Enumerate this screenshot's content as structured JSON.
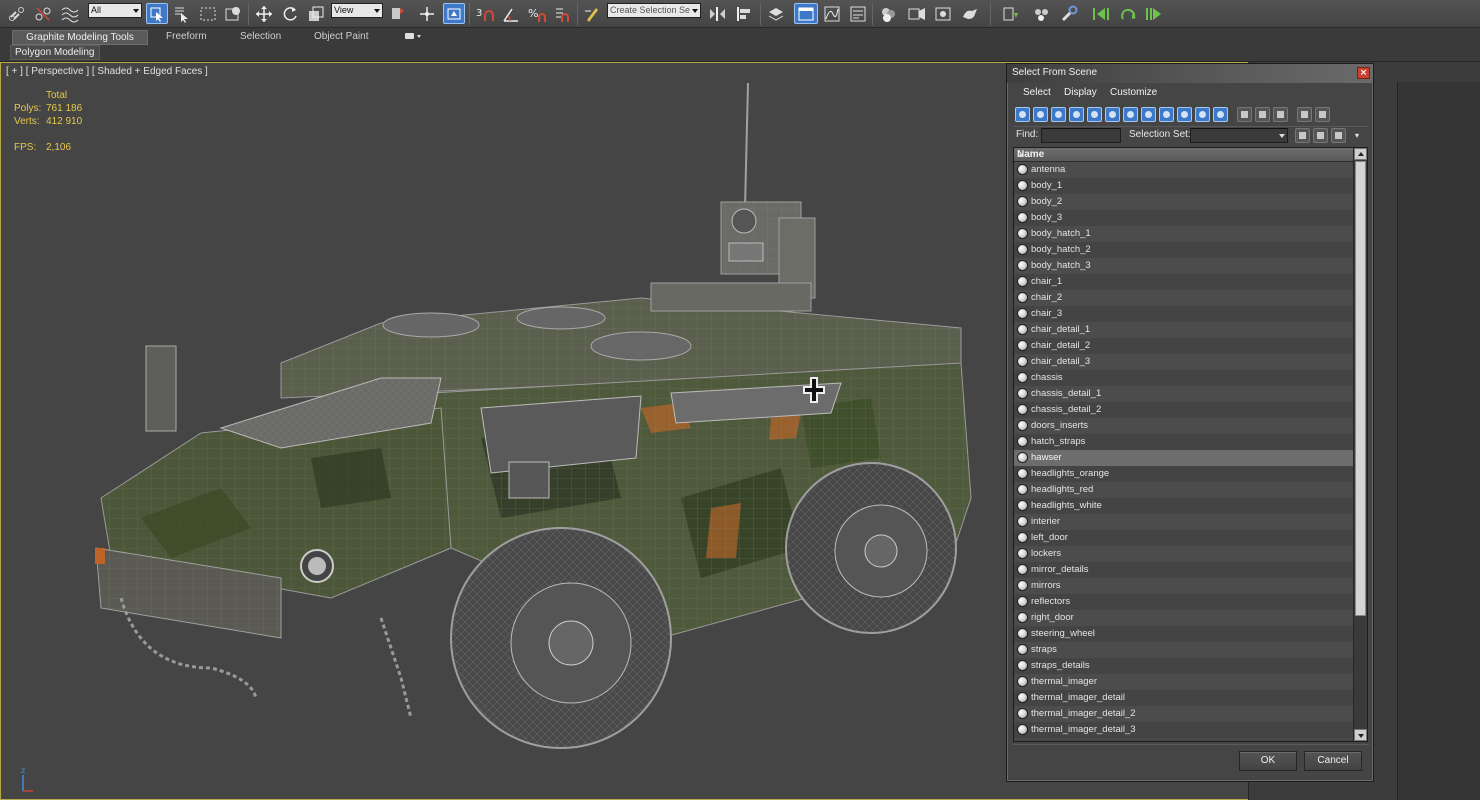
{
  "toolbar": {
    "filter_selected": "All",
    "ref_coord_selected": "View",
    "named_selection_placeholder": "Create Selection Se",
    "snap_labels": [
      "3",
      "%"
    ],
    "icons": [
      "link-icon",
      "unlink-icon",
      "bind-space-warp-icon",
      "select-object-icon",
      "select-by-name-icon",
      "rect-selection-icon",
      "window-crossing-icon",
      "move-icon",
      "rotate-icon",
      "scale-icon",
      "pivot-icon",
      "select-manipulate-icon",
      "keyboard-shortcut-icon",
      "snap-icon",
      "angle-snap-icon",
      "percent-snap-icon",
      "spinner-snap-icon",
      "edit-named-selection-icon",
      "mirror-icon",
      "align-icon",
      "layer-explorer-icon",
      "scene-explorer-icon",
      "curve-editor-icon",
      "schematic-view-icon",
      "material-editor-icon",
      "render-setup-icon",
      "rendered-frame-icon",
      "render-icon",
      "keyframe-icon",
      "set-key-icon"
    ]
  },
  "ribbon": {
    "tabs": [
      "Graphite Modeling Tools",
      "Freeform",
      "Selection",
      "Object Paint"
    ],
    "active_tab": "Graphite Modeling Tools",
    "sub_tab": "Polygon Modeling"
  },
  "viewport": {
    "label": "[ + ] [ Perspective ] [ Shaded + Edged Faces ]",
    "stats": {
      "total_label": "Total",
      "polys_label": "Polys:",
      "polys_value": "761 186",
      "verts_label": "Verts:",
      "verts_value": "412 910",
      "fps_label": "FPS:",
      "fps_value": "2,106"
    },
    "axis_label": "z",
    "stats_color": "#e6c84a",
    "border_color": "#b8a84a"
  },
  "dialog": {
    "title": "Select From Scene",
    "menu": [
      "Select",
      "Display",
      "Customize"
    ],
    "find_label": "Find:",
    "find_value": "",
    "selection_set_label": "Selection Set:",
    "selection_set_value": "",
    "column_header": "Name",
    "objects": [
      "antenna",
      "body_1",
      "body_2",
      "body_3",
      "body_hatch_1",
      "body_hatch_2",
      "body_hatch_3",
      "chair_1",
      "chair_2",
      "chair_3",
      "chair_detail_1",
      "chair_detail_2",
      "chair_detail_3",
      "chassis",
      "chassis_detail_1",
      "chassis_detail_2",
      "doors_inserts",
      "hatch_straps",
      "hawser",
      "headlights_orange",
      "headlights_red",
      "headlights_white",
      "interier",
      "left_door",
      "lockers",
      "mirror_details",
      "mirrors",
      "reflectors",
      "right_door",
      "steering_wheel",
      "straps",
      "straps_details",
      "thermal_imager",
      "thermal_imager_detail",
      "thermal_imager_detail_2",
      "thermal_imager_detail_3"
    ],
    "selected_object": "hawser",
    "ok_label": "OK",
    "cancel_label": "Cancel",
    "accent_color": "#3d79c9"
  }
}
